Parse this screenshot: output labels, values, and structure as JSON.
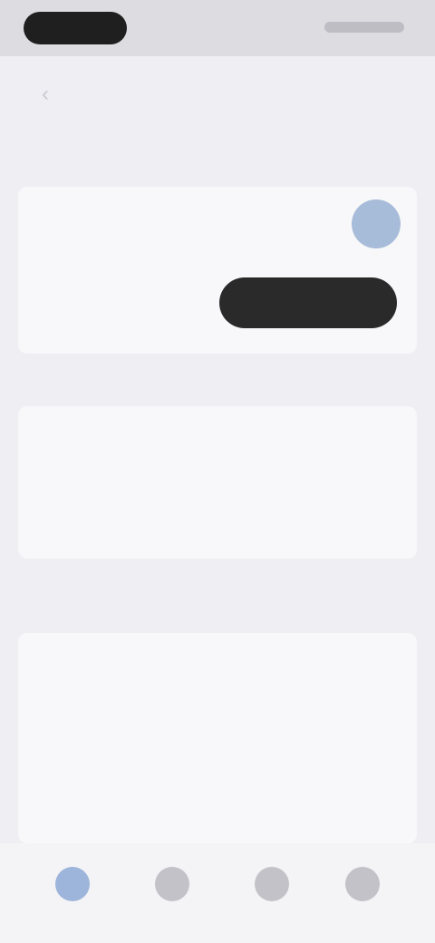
{
  "status_bar": {
    "left_pill": "",
    "right": ""
  },
  "header": {
    "back_icon": "chevron-left-icon",
    "title": ""
  },
  "section1": {
    "label": "",
    "tabs": [
      "",
      "",
      "",
      ""
    ],
    "sub": "",
    "link": "",
    "action": ""
  },
  "section2": {
    "label": "",
    "empty_text": "",
    "empty_link": "",
    "empty_footer": ""
  },
  "notes": [
    "",
    ""
  ],
  "details": {
    "title": "",
    "rows": [
      {
        "k": "",
        "v": ""
      },
      {
        "k": "",
        "v": ""
      },
      {
        "k": "",
        "v": ""
      }
    ]
  },
  "tabbar": {
    "items": [
      "",
      "",
      "",
      ""
    ],
    "active_index": 0
  },
  "colors": {
    "background": "#eeeef3",
    "card": "#f8f8fb",
    "accent": "#9db5da",
    "dark_button": "#2a2a2a"
  }
}
